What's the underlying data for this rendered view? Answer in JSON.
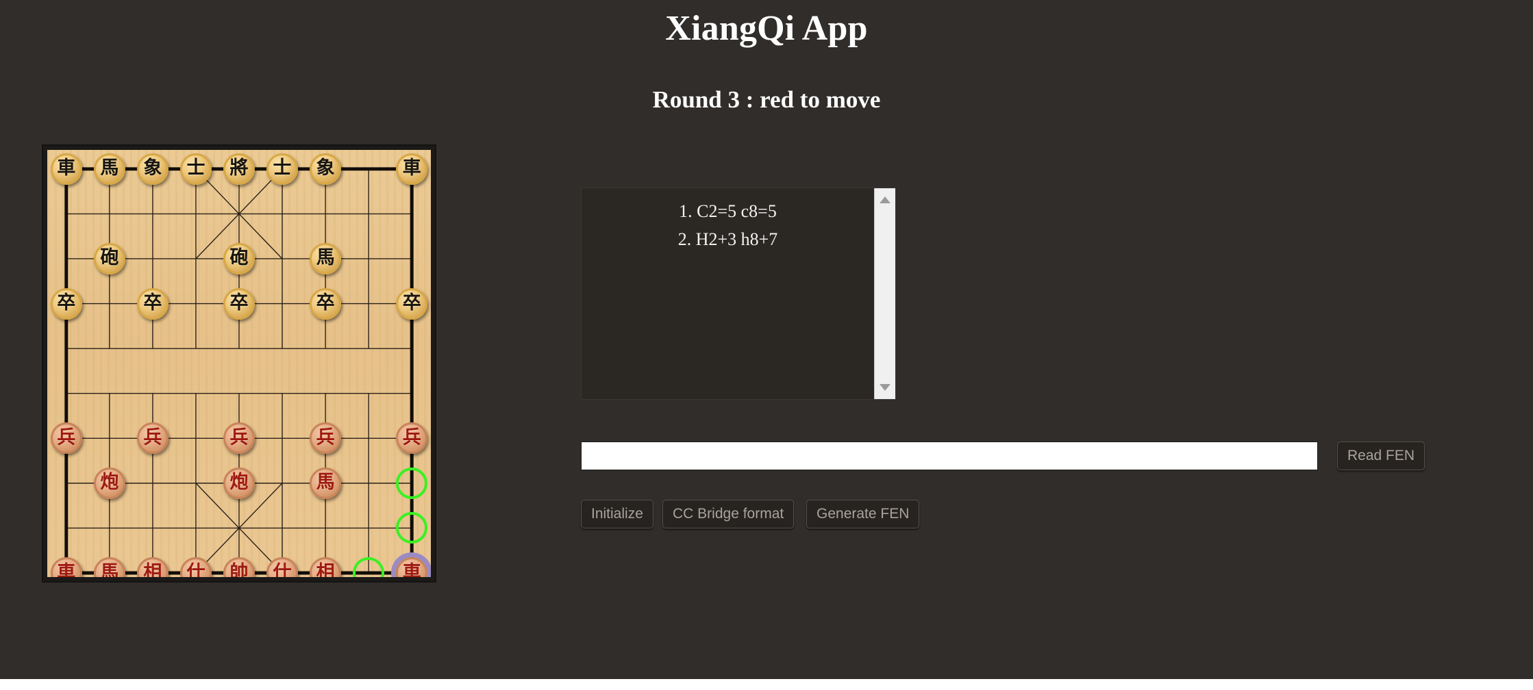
{
  "header": {
    "app_title": "XiangQi App",
    "round_status": "Round 3 : red to move"
  },
  "move_list": {
    "rows": [
      "1. C2=5 c8=5",
      "2. H2+3 h8+7"
    ],
    "scrollbar": {
      "up_arrow": "scroll-up",
      "down_arrow": "scroll-down"
    }
  },
  "fen": {
    "value": "",
    "placeholder": "",
    "read_button": "Read FEN"
  },
  "toolbar": {
    "initialize": "Initialize",
    "cc_bridge": "CC Bridge format",
    "generate_fen": "Generate FEN"
  },
  "colors": {
    "page_background": "#302D2A",
    "board_wood": "#E6C189",
    "board_border": "#1c1a18",
    "black_piece_face": "#EFC984",
    "black_piece_text": "#17150F",
    "red_piece_face": "#E3AB85",
    "red_piece_text": "#9E1A10",
    "move_hint": "#3BF023",
    "selected_halo": "#9B8BC4",
    "text_primary": "#FFFFFF",
    "button_text": "#A9A39C",
    "button_face": "#262320",
    "scrollbar_track": "#F0F0F0"
  },
  "board": {
    "files": 9,
    "ranks": 10,
    "pieces": [
      {
        "name": "black-chariot-left",
        "glyph": "車",
        "side": "black",
        "col": 0,
        "row": 0
      },
      {
        "name": "black-horse-left",
        "glyph": "馬",
        "side": "black",
        "col": 1,
        "row": 0
      },
      {
        "name": "black-elephant-left",
        "glyph": "象",
        "side": "black",
        "col": 2,
        "row": 0
      },
      {
        "name": "black-advisor-left",
        "glyph": "士",
        "side": "black",
        "col": 3,
        "row": 0
      },
      {
        "name": "black-general",
        "glyph": "將",
        "side": "black",
        "col": 4,
        "row": 0
      },
      {
        "name": "black-advisor-right",
        "glyph": "士",
        "side": "black",
        "col": 5,
        "row": 0
      },
      {
        "name": "black-elephant-right",
        "glyph": "象",
        "side": "black",
        "col": 6,
        "row": 0
      },
      {
        "name": "black-chariot-right",
        "glyph": "車",
        "side": "black",
        "col": 8,
        "row": 0
      },
      {
        "name": "black-cannon-left",
        "glyph": "砲",
        "side": "black",
        "col": 1,
        "row": 2
      },
      {
        "name": "black-cannon-right",
        "glyph": "砲",
        "side": "black",
        "col": 4,
        "row": 2
      },
      {
        "name": "black-horse-right",
        "glyph": "馬",
        "side": "black",
        "col": 6,
        "row": 2
      },
      {
        "name": "black-soldier-1",
        "glyph": "卒",
        "side": "black",
        "col": 0,
        "row": 3
      },
      {
        "name": "black-soldier-2",
        "glyph": "卒",
        "side": "black",
        "col": 2,
        "row": 3
      },
      {
        "name": "black-soldier-3",
        "glyph": "卒",
        "side": "black",
        "col": 4,
        "row": 3
      },
      {
        "name": "black-soldier-4",
        "glyph": "卒",
        "side": "black",
        "col": 6,
        "row": 3
      },
      {
        "name": "black-soldier-5",
        "glyph": "卒",
        "side": "black",
        "col": 8,
        "row": 3
      },
      {
        "name": "red-soldier-1",
        "glyph": "兵",
        "side": "red",
        "col": 0,
        "row": 6
      },
      {
        "name": "red-soldier-2",
        "glyph": "兵",
        "side": "red",
        "col": 2,
        "row": 6
      },
      {
        "name": "red-soldier-3",
        "glyph": "兵",
        "side": "red",
        "col": 4,
        "row": 6
      },
      {
        "name": "red-soldier-4",
        "glyph": "兵",
        "side": "red",
        "col": 6,
        "row": 6
      },
      {
        "name": "red-soldier-5",
        "glyph": "兵",
        "side": "red",
        "col": 8,
        "row": 6
      },
      {
        "name": "red-cannon-left",
        "glyph": "炮",
        "side": "red",
        "col": 1,
        "row": 7
      },
      {
        "name": "red-cannon-right",
        "glyph": "炮",
        "side": "red",
        "col": 4,
        "row": 7
      },
      {
        "name": "red-horse-right",
        "glyph": "馬",
        "side": "red",
        "col": 6,
        "row": 7
      },
      {
        "name": "red-chariot-left",
        "glyph": "車",
        "side": "red",
        "col": 0,
        "row": 9
      },
      {
        "name": "red-horse-left",
        "glyph": "馬",
        "side": "red",
        "col": 1,
        "row": 9
      },
      {
        "name": "red-elephant-left",
        "glyph": "相",
        "side": "red",
        "col": 2,
        "row": 9
      },
      {
        "name": "red-advisor-left",
        "glyph": "仕",
        "side": "red",
        "col": 3,
        "row": 9
      },
      {
        "name": "red-general",
        "glyph": "帥",
        "side": "red",
        "col": 4,
        "row": 9
      },
      {
        "name": "red-advisor-right",
        "glyph": "仕",
        "side": "red",
        "col": 5,
        "row": 9
      },
      {
        "name": "red-elephant-right",
        "glyph": "相",
        "side": "red",
        "col": 6,
        "row": 9
      },
      {
        "name": "red-chariot-right",
        "glyph": "車",
        "side": "red",
        "col": 8,
        "row": 9,
        "selected": true
      }
    ],
    "move_hints": [
      {
        "name": "move-hint-col8-row7",
        "col": 8,
        "row": 7
      },
      {
        "name": "move-hint-col8-row8",
        "col": 8,
        "row": 8
      },
      {
        "name": "move-hint-col7-row9",
        "col": 7,
        "row": 9
      }
    ]
  }
}
